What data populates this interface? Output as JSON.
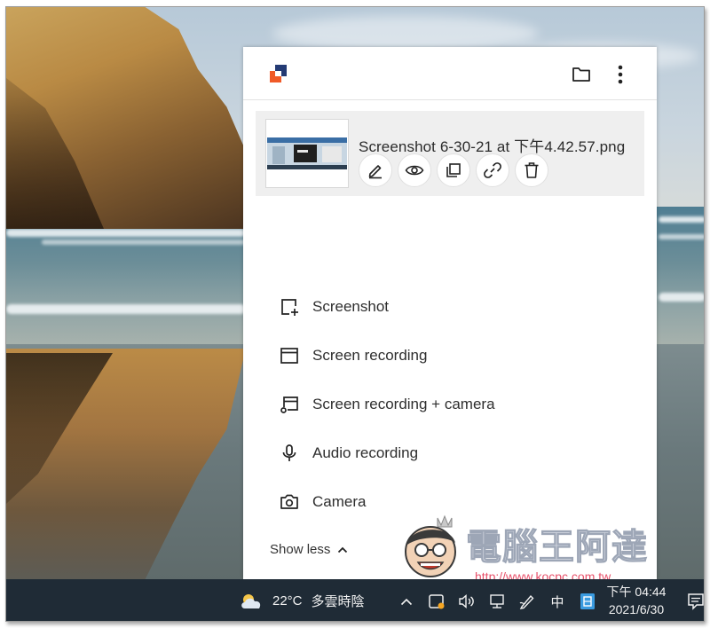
{
  "panel": {
    "file": {
      "name": "Screenshot 6-30-21 at 下午4.42.57.png",
      "actions": [
        "edit-icon",
        "preview-icon",
        "copy-icon",
        "link-icon",
        "delete-icon"
      ]
    },
    "menu": [
      {
        "icon": "screenshot-icon",
        "label": "Screenshot"
      },
      {
        "icon": "screen-recording-icon",
        "label": "Screen recording"
      },
      {
        "icon": "screen-camera-icon",
        "label": "Screen recording + camera"
      },
      {
        "icon": "microphone-icon",
        "label": "Audio recording"
      },
      {
        "icon": "camera-icon",
        "label": "Camera"
      }
    ],
    "show_less": "Show less"
  },
  "watermark": {
    "title": "電腦王阿達",
    "url": "http://www.kocpc.com.tw"
  },
  "taskbar": {
    "temperature": "22°C",
    "condition": "多雲時陰",
    "ime": "中",
    "time": "下午 04:44",
    "date": "2021/6/30"
  },
  "colors": {
    "logo_orange": "#f05a28",
    "logo_blue": "#243b74",
    "taskbar_bg": "#1f2b36",
    "card_bg": "#efefef"
  }
}
